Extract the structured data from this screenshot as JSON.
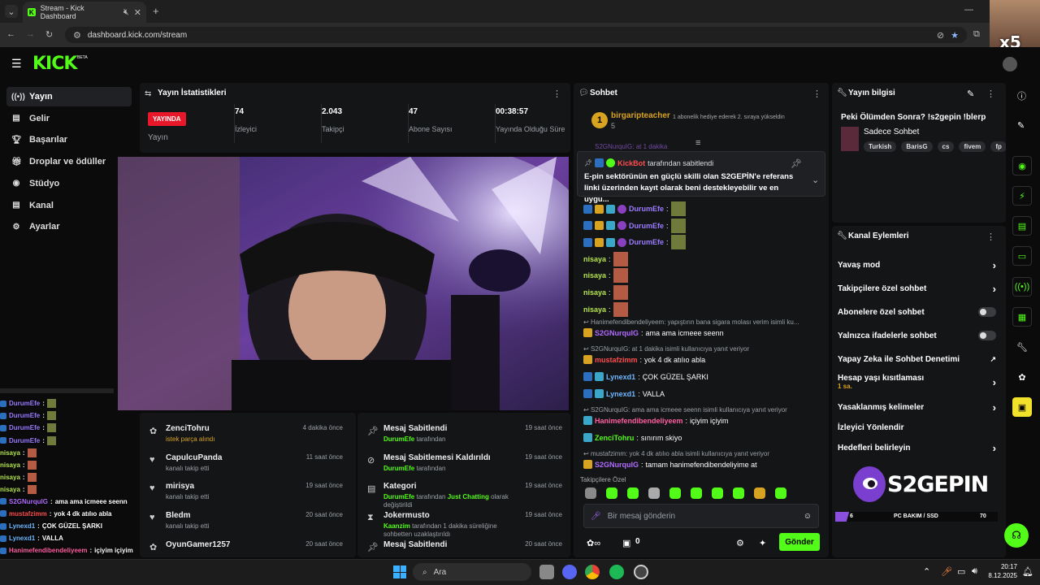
{
  "browser": {
    "tab_title": "Stream - Kick Dashboard",
    "url": "dashboard.kick.com/stream"
  },
  "logo": {
    "text": "KICK",
    "beta": "BETA"
  },
  "webcam_overlay": "x5",
  "sidebar": {
    "items": [
      {
        "label": "Yayın",
        "icon": "broadcast-icon"
      },
      {
        "label": "Gelir",
        "icon": "revenue-icon"
      },
      {
        "label": "Başarılar",
        "icon": "trophy-icon"
      },
      {
        "label": "Droplar ve ödüller",
        "icon": "gift-icon"
      },
      {
        "label": "Stüdyo",
        "icon": "studio-icon"
      },
      {
        "label": "Kanal",
        "icon": "channel-icon"
      },
      {
        "label": "Ayarlar",
        "icon": "gear-icon"
      }
    ]
  },
  "stats": {
    "title": "Yayın İstatistikleri",
    "live_badge": "YAYINDA",
    "live_label": "Yayın",
    "items": [
      {
        "value": "74",
        "label": "İzleyici"
      },
      {
        "value": "2.043",
        "label": "Takipçi"
      },
      {
        "value": "47",
        "label": "Abone Sayısı"
      },
      {
        "value": "00:38:57",
        "label": "Yayında Olduğu Süre"
      }
    ]
  },
  "activity_left": [
    {
      "name": "ZenciTohru",
      "sub": "istek parça alındı",
      "time": "4 dakika önce"
    },
    {
      "name": "CapulcuPanda",
      "sub": "kanalı takip etti",
      "time": "11 saat önce"
    },
    {
      "name": "mirisya",
      "sub": "kanalı takip etti",
      "time": "19 saat önce"
    },
    {
      "name": "Bledm",
      "sub": "kanalı takip etti",
      "time": "20 saat önce"
    },
    {
      "name": "OyunGamer1257",
      "sub": "",
      "time": "20 saat önce"
    }
  ],
  "activity_right": [
    {
      "name": "Mesaj Sabitlendi",
      "by": "DurumEfe",
      "sub": "tarafından",
      "time": "19 saat önce"
    },
    {
      "name": "Mesaj Sabitlemesi Kaldırıldı",
      "by": "DurumEfe",
      "sub": "tarafından",
      "time": "19 saat önce"
    },
    {
      "name": "Kategori",
      "by": "DurumEfe",
      "sub": "tarafından",
      "cat": "Just Chatting",
      "sub2": "olarak değiştirildi",
      "time": "19 saat önce"
    },
    {
      "name": "Jokermusto",
      "by": "Kaanzim",
      "sub": "tarafından 1 dakika süreliğine sohbetten uzaklaştırıldı",
      "time": "19 saat önce"
    },
    {
      "name": "Mesaj Sabitlendi",
      "by": "",
      "sub": "",
      "time": "20 saat önce"
    }
  ],
  "chat": {
    "title": "Sohbet",
    "top_gifter": "birgaripteacher",
    "top_gifter_count": "5",
    "gift_text": "1 abonelik hediye ederek 2. sıraya yükseldin",
    "pinned_by": "KickBot",
    "pinned_suffix": "tarafından sabitlendi",
    "pinned_text": "E-pin sektörünün en güçlü skilli olan S2GEPİN'e referans linki üzerinden kayıt olarak beni destekleyebilir ve en uygu...",
    "partial_top": "S2GNurquIG: at 1 dakika",
    "messages": [
      {
        "user": "DurumEfe",
        "color": "#9b7bff",
        "text": "",
        "emote": "green"
      },
      {
        "user": "DurumEfe",
        "color": "#9b7bff",
        "text": "",
        "emote": "green"
      },
      {
        "user": "DurumEfe",
        "color": "#9b7bff",
        "text": "",
        "emote": "green"
      },
      {
        "user": "nisaya",
        "color": "#b4e34c",
        "text": "",
        "emote": "red"
      },
      {
        "user": "nisaya",
        "color": "#b4e34c",
        "text": "",
        "emote": "red"
      },
      {
        "user": "nisaya",
        "color": "#b4e34c",
        "text": "",
        "emote": "red"
      },
      {
        "user": "nisaya",
        "color": "#b4e34c",
        "text": "",
        "emote": "red"
      },
      {
        "reply": "Hanimefendibendeliyeem: yapıştırın bana sigara molası verim isimli ku...",
        "user": "S2GNurquIG",
        "color": "#b06bff",
        "text": "ama ama icmeee seenn"
      },
      {
        "reply": "S2GNurquIG: at 1 dakika isimli kullanıcıya yanıt veriyor",
        "user": "mustafzimm",
        "color": "#ff4d4d",
        "text": "yok 4 dk atılıo abla"
      },
      {
        "user": "Lynexd1",
        "color": "#6fb8ff",
        "text": "ÇOK GÜZEL ŞARKI"
      },
      {
        "user": "Lynexd1",
        "color": "#6fb8ff",
        "text": "VALLA"
      },
      {
        "reply": "S2GNurquIG: ama ama icmeee seenn isimli kullanıcıya yanıt veriyor",
        "user": "Hanimefendibendeliyeem",
        "color": "#ff5fa2",
        "text": "içiyim içiyim"
      },
      {
        "user": "ZenciTohru",
        "color": "#53fc18",
        "text": "sınırım skiyo"
      },
      {
        "reply": "mustafzimm: yok 4 dk atılıo abla isimli kullanıcıya yanıt veriyor",
        "user": "S2GNurquIG",
        "color": "#b06bff",
        "text": "tamam hanimefendibendeliyime at"
      }
    ],
    "emote_section": "Takipçilere Özel",
    "input_placeholder": "Bir mesaj gönderin",
    "kicks": "0",
    "send_label": "Gönder"
  },
  "stream_info": {
    "title": "Yayın bilgisi",
    "stream_title": "Peki Ölümden Sonra? !s2gepin !blerp",
    "category": "Sadece Sohbet",
    "tags": [
      "Turkish",
      "BarisG",
      "cs",
      "fivem",
      "fp"
    ]
  },
  "channel_actions": {
    "title": "Kanal Eylemleri",
    "items": [
      {
        "label": "Yavaş mod",
        "type": "arrow"
      },
      {
        "label": "Takipçilere özel sohbet",
        "type": "arrow"
      },
      {
        "label": "Abonelere özel sohbet",
        "type": "toggle"
      },
      {
        "label": "Yalnızca ifadelerle sohbet",
        "type": "toggle"
      },
      {
        "label": "Yapay Zeka ile Sohbet Denetimi",
        "type": "external"
      },
      {
        "label": "Hesap yaşı kısıtlaması",
        "sub": "1 sa.",
        "type": "arrow"
      },
      {
        "label": "Yasaklanmış kelimeler",
        "type": "arrow"
      },
      {
        "label": "İzleyici Yönlendir",
        "type": "none"
      },
      {
        "label": "Hedefleri belirleyin",
        "type": "arrow"
      }
    ]
  },
  "sponsor": {
    "name": "S2GEPIN",
    "bar_left": "6",
    "bar_label": "PC BAKIM / SSD",
    "bar_right": "70",
    "progress": 0.086
  },
  "overlay_chat": [
    {
      "user": "DurumEfe",
      "color": "#9b7bff",
      "text": ""
    },
    {
      "user": "DurumEfe",
      "color": "#9b7bff",
      "text": ""
    },
    {
      "user": "DurumEfe",
      "color": "#9b7bff",
      "text": ""
    },
    {
      "user": "DurumEfe",
      "color": "#9b7bff",
      "text": ""
    },
    {
      "user": "nisaya",
      "color": "#b4e34c",
      "text": ""
    },
    {
      "user": "nisaya",
      "color": "#b4e34c",
      "text": ""
    },
    {
      "user": "nisaya",
      "color": "#b4e34c",
      "text": ""
    },
    {
      "user": "nisaya",
      "color": "#b4e34c",
      "text": ""
    },
    {
      "user": "S2GNurquIG",
      "color": "#b06bff",
      "text": "ama ama icmeee seenn"
    },
    {
      "user": "mustafzimm",
      "color": "#ff4d4d",
      "text": "yok 4 dk atılıo abla"
    },
    {
      "user": "Lynexd1",
      "color": "#6fb8ff",
      "text": "ÇOK GÜZEL ŞARKI"
    },
    {
      "user": "Lynexd1",
      "color": "#6fb8ff",
      "text": "VALLA"
    },
    {
      "user": "Hanimefendibendeliyeem",
      "color": "#ff5fa2",
      "text": "içiyim içiyim"
    },
    {
      "user": "ZenciTohru",
      "color": "#53fc18",
      "text": "sınırım skiyo"
    },
    {
      "user": "S2GNurquIG",
      "color": "#b06bff",
      "text": "tamam hanimefendibendeliyime at"
    }
  ],
  "taskbar": {
    "search": "Ara",
    "time": "20:17",
    "date": "8.12.2025"
  }
}
